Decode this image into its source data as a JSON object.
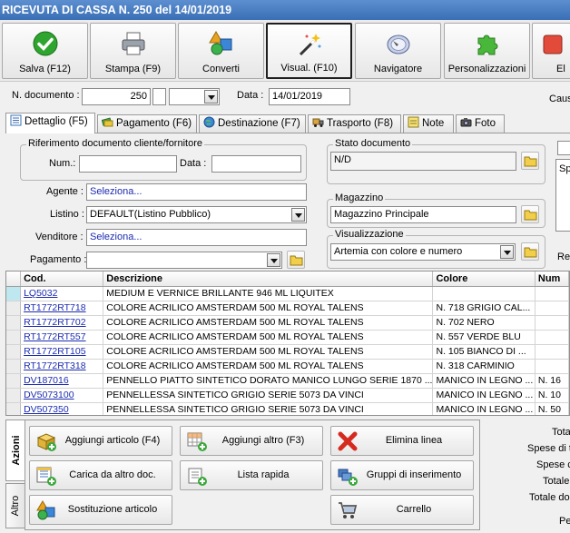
{
  "window": {
    "title": "RICEVUTA DI CASSA N. 250 del 14/01/2019"
  },
  "toolbar": [
    {
      "label": "Salva (F12)",
      "icon": "check-icon"
    },
    {
      "label": "Stampa (F9)",
      "icon": "printer-icon"
    },
    {
      "label": "Converti",
      "icon": "shapes-icon"
    },
    {
      "label": "Visual. (F10)",
      "icon": "magic-wand-icon"
    },
    {
      "label": "Navigatore",
      "icon": "compass-icon"
    },
    {
      "label": "Personalizzazioni",
      "icon": "puzzle-icon"
    },
    {
      "label": "El",
      "icon": "partial-icon"
    }
  ],
  "header": {
    "doc_number_label": "N. documento :",
    "doc_number": "250",
    "date_label": "Data :",
    "date": "14/01/2019",
    "causale_label": "Caus"
  },
  "tabs": [
    {
      "label": "Dettaglio (F5)",
      "active": true
    },
    {
      "label": "Pagamento (F6)",
      "active": false
    },
    {
      "label": "Destinazione (F7)",
      "active": false
    },
    {
      "label": "Trasporto (F8)",
      "active": false
    },
    {
      "label": "Note",
      "active": false
    },
    {
      "label": "Foto",
      "active": false
    }
  ],
  "form": {
    "riferimento_title": "Riferimento documento cliente/fornitore",
    "num_label": "Num.:",
    "num_value": "",
    "data_label": "Data :",
    "data_value": "",
    "agente_label": "Agente :",
    "agente_value": "Seleziona...",
    "listino_label": "Listino :",
    "listino_value": "DEFAULT(Listino Pubblico)",
    "venditore_label": "Venditore :",
    "venditore_value": "Seleziona...",
    "pagamento_label": "Pagamento :",
    "pagamento_value": "",
    "stato_title": "Stato documento",
    "stato_value": "N/D",
    "magazzino_title": "Magazzino",
    "magazzino_value": "Magazzino Principale",
    "visualizzazione_title": "Visualizzazione",
    "visualizzazione_value": "Artemia con colore e numero",
    "right_partial_1": "Spe",
    "right_partial_2": "Ret"
  },
  "grid": {
    "columns": [
      "Cod.",
      "Descrizione",
      "Colore",
      "Num"
    ],
    "rows": [
      {
        "code": "LQ5032",
        "desc": "MEDIUM E VERNICE BRILLANTE 946 ML LIQUITEX",
        "color": "",
        "num": ""
      },
      {
        "code": "RT1772RT718",
        "desc": "COLORE ACRILICO AMSTERDAM 500 ML ROYAL TALENS",
        "color": "N. 718 GRIGIO CAL...",
        "num": ""
      },
      {
        "code": "RT1772RT702",
        "desc": "COLORE ACRILICO AMSTERDAM 500 ML ROYAL TALENS",
        "color": "N. 702 NERO",
        "num": ""
      },
      {
        "code": "RT1772RT557",
        "desc": "COLORE ACRILICO AMSTERDAM 500 ML ROYAL TALENS",
        "color": "N. 557 VERDE BLU",
        "num": ""
      },
      {
        "code": "RT1772RT105",
        "desc": "COLORE ACRILICO AMSTERDAM 500 ML ROYAL TALENS",
        "color": "N. 105 BIANCO DI ...",
        "num": ""
      },
      {
        "code": "RT1772RT318",
        "desc": "COLORE ACRILICO AMSTERDAM 500 ML ROYAL TALENS",
        "color": "N. 318 CARMINIO",
        "num": ""
      },
      {
        "code": "DV187016",
        "desc": "PENNELLO PIATTO SINTETICO DORATO MANICO LUNGO SERIE 1870 ...",
        "color": "MANICO IN LEGNO ...",
        "num": "N. 16"
      },
      {
        "code": "DV5073100",
        "desc": "PENNELLESSA SINTETICO GRIGIO SERIE 5073 DA VINCI",
        "color": "MANICO IN LEGNO ...",
        "num": "N. 10"
      },
      {
        "code": "DV507350",
        "desc": "PENNELLESSA SINTETICO GRIGIO SERIE 5073 DA VINCI",
        "color": "MANICO IN LEGNO ...",
        "num": "N. 50"
      }
    ]
  },
  "side_tabs": {
    "azioni": "Azioni",
    "altro": "Altro"
  },
  "actions": [
    {
      "label": "Aggiungi articolo (F4)",
      "icon": "add-box-icon"
    },
    {
      "label": "Aggiungi altro (F3)",
      "icon": "add-grid-icon"
    },
    {
      "label": "Elimina linea",
      "icon": "delete-x-icon"
    },
    {
      "label": "Carica da altro doc.",
      "icon": "load-doc-icon"
    },
    {
      "label": "Lista rapida",
      "icon": "quick-list-icon"
    },
    {
      "label": "Gruppi di inserimento",
      "icon": "group-insert-icon"
    },
    {
      "label": "Sostituzione articolo",
      "icon": "replace-item-icon"
    },
    {
      "label": "Carrello",
      "icon": "cart-icon"
    }
  ],
  "totals": {
    "tota": "Tota",
    "spese_di_t": "Spese di t",
    "spese_c": "Spese c",
    "totale_1": "Totale",
    "totale_do": "Totale do",
    "pe": "Pe"
  }
}
